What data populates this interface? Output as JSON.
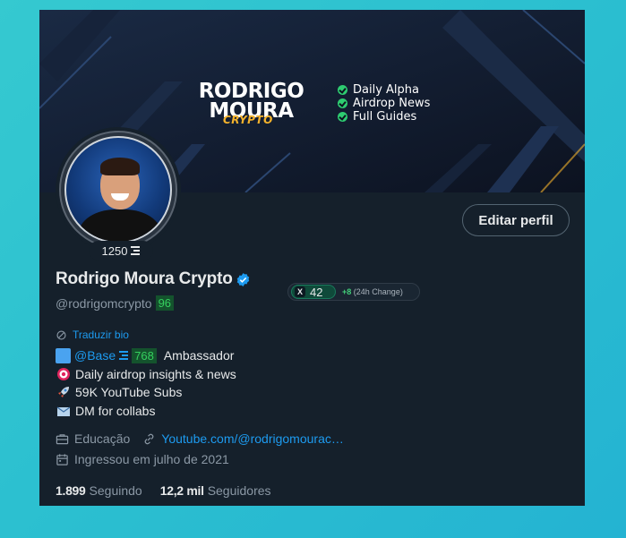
{
  "banner": {
    "logo_line1": "RODRIGO",
    "logo_line2": "MOURA",
    "logo_sub": "CRYPTO",
    "features": [
      "Daily Alpha",
      "Airdrop News",
      "Full Guides"
    ]
  },
  "avatar_badge": "1250",
  "edit_button": "Editar perfil",
  "profile": {
    "name": "Rodrigo Moura Crypto",
    "handle": "@rodrigomcrypto",
    "handle_badge": "96",
    "score": "42",
    "score_change": "+8",
    "score_change_label": "(24h Change)"
  },
  "translate_label": "Traduzir bio",
  "bio": {
    "line1_link": "@Base",
    "line1_badge": "768",
    "line1_text": "Ambassador",
    "line2": "Daily airdrop insights & news",
    "line3": "59K YouTube Subs",
    "line4": "DM for collabs"
  },
  "meta": {
    "category": "Educação",
    "website": "Youtube.com/@rodrigomourac…",
    "joined": "Ingressou em julho de 2021"
  },
  "stats": {
    "following_count": "1.899",
    "following_label": "Seguindo",
    "followers_count": "12,2 mil",
    "followers_label": "Seguidores"
  },
  "colors": {
    "accent": "#1d9bf0",
    "background": "#15202b",
    "badge_green": "#35d05e"
  }
}
